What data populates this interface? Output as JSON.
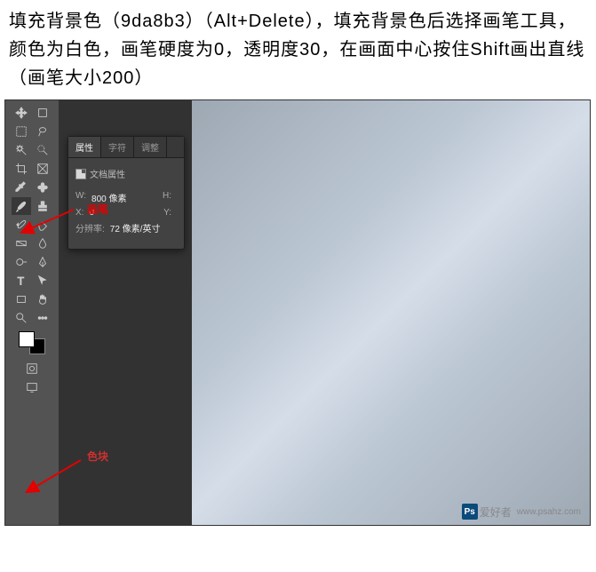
{
  "instruction_text": "填充背景色（9da8b3）（Alt+Delete），填充背景色后选择画笔工具，颜色为白色，画笔硬度为0，透明度30，在画面中心按住Shift画出直线（画笔大小200）",
  "panel": {
    "tabs": {
      "properties": "属性",
      "character": "字符",
      "adjust": "调整"
    },
    "doc_label": "文档属性",
    "w_label": "W:",
    "w_value": "800 像素",
    "h_label": "H:",
    "h_value": "",
    "x_label": "X:",
    "x_value": "0",
    "y_label": "Y:",
    "y_value": "",
    "res_label": "分辨率:",
    "res_value": "72 像素/英寸"
  },
  "annotations": {
    "brush": "画笔",
    "swatch": "色块"
  },
  "watermark": {
    "badge": "Ps",
    "text": "爱好者",
    "url": "www.psahz.com"
  }
}
